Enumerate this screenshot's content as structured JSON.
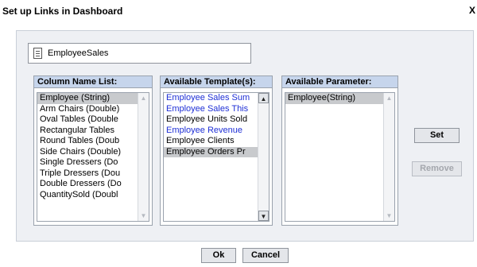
{
  "dialog": {
    "title": "Set up Links in Dashboard",
    "close_label": "X"
  },
  "file": {
    "name": "EmployeeSales",
    "icon": "document-icon"
  },
  "column_list": {
    "header": "Column Name List:",
    "items": [
      {
        "label": "Employee (String)",
        "selected": true
      },
      {
        "label": "Arm Chairs (Double)"
      },
      {
        "label": "Oval Tables (Double"
      },
      {
        "label": "Rectangular Tables"
      },
      {
        "label": "Round Tables (Doub"
      },
      {
        "label": "Side Chairs (Double)"
      },
      {
        "label": "Single Dressers (Do"
      },
      {
        "label": "Triple Dressers (Dou"
      },
      {
        "label": "Double Dressers (Do"
      },
      {
        "label": "QuantitySold (Doubl"
      }
    ]
  },
  "template_list": {
    "header": "Available Template(s):",
    "items": [
      {
        "label": "Employee Sales Sum",
        "link": true
      },
      {
        "label": "Employee Sales This",
        "link": true
      },
      {
        "label": "Employee Units Sold"
      },
      {
        "label": "Employee Revenue",
        "link": true
      },
      {
        "label": "Employee Clients"
      },
      {
        "label": "Employee Orders Pr",
        "selected": true
      }
    ]
  },
  "parameter_list": {
    "header": "Available Parameter:",
    "items": [
      {
        "label": "Employee(String)",
        "selected": true
      }
    ]
  },
  "buttons": {
    "set": "Set",
    "remove": "Remove",
    "ok": "Ok",
    "cancel": "Cancel"
  },
  "colors": {
    "header_bg": "#c6d5ec",
    "link_text": "#1e2fd6",
    "selected_bg": "#c8cacd"
  }
}
